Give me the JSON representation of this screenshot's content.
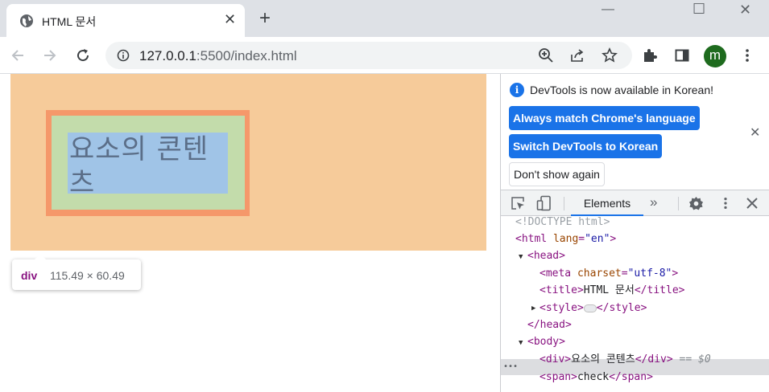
{
  "tab": {
    "title": "HTML 문서",
    "close_glyph": "✕"
  },
  "new_tab_glyph": "+",
  "window": {
    "minimize": "—",
    "maximize": "☐",
    "close": "✕"
  },
  "toolbar": {
    "url_host": "127.0.0.1",
    "url_rest": ":5500/index.html",
    "avatar_letter": "m"
  },
  "page": {
    "content_text": "요소의 콘텐츠",
    "tooltip": {
      "tag": "div",
      "size": "115.49 × 60.49"
    }
  },
  "devtools": {
    "info_text": "DevTools is now available in Korean!",
    "btn_match": "Always match Chrome's language",
    "btn_switch": "Switch DevTools to Korean",
    "btn_dont_show": "Don't show again",
    "tab_elements": "Elements",
    "more_tabs": "»",
    "dom": {
      "doctype": "<!DOCTYPE html>",
      "html_open": "<html",
      "html_attr": "lang",
      "html_val": "\"en\"",
      "head_open": "<head>",
      "meta_open": "<meta",
      "meta_attr": "charset",
      "meta_val": "\"utf-8\"",
      "title_open": "<title>",
      "title_text": "HTML 문서",
      "title_close": "</title>",
      "style_open": "<style>",
      "style_close": "</style>",
      "head_close": "</head>",
      "body_open": "<body>",
      "div_open": "<div>",
      "div_text": "요소의 콘텐츠",
      "div_close": "</div>",
      "div_marker": "== $0",
      "span_open": "<span>",
      "span_text": "check",
      "span_close": "</span>",
      "row_dots": "•••"
    }
  }
}
